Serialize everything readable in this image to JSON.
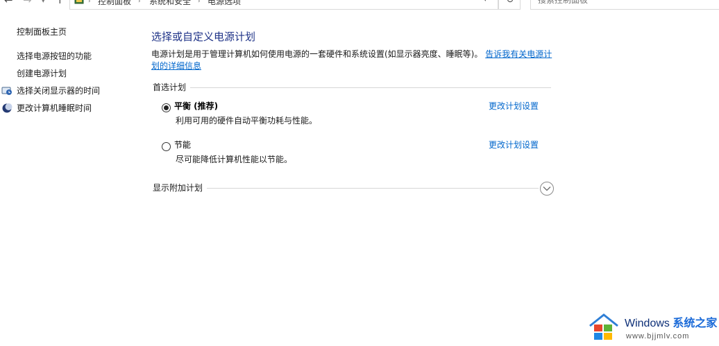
{
  "address_bar": {
    "breadcrumbs": [
      "控制面板",
      "系统和安全",
      "电源选项"
    ],
    "search_placeholder": "搜索控制面板"
  },
  "sidebar": {
    "home": "控制面板主页",
    "items": [
      {
        "label": "选择电源按钮的功能"
      },
      {
        "label": "创建电源计划"
      },
      {
        "label": "选择关闭显示器的时间"
      },
      {
        "label": "更改计算机睡眠时间"
      }
    ]
  },
  "main": {
    "title": "选择或自定义电源计划",
    "description": "电源计划是用于管理计算机如何使用电源的一套硬件和系统设置(如显示器亮度、睡眠等)。",
    "description_link": "告诉我有关电源计划的详细信息",
    "preferred_label": "首选计划",
    "plans": [
      {
        "name": "平衡 (推荐)",
        "desc": "利用可用的硬件自动平衡功耗与性能。",
        "link": "更改计划设置",
        "selected": true
      },
      {
        "name": "节能",
        "desc": "尽可能降低计算机性能以节能。",
        "link": "更改计划设置",
        "selected": false
      }
    ],
    "additional_label": "显示附加计划"
  },
  "watermark": {
    "brand": "Windows",
    "brand_cn": "系统之家",
    "url": "www.bjjmlv.com"
  },
  "colors": {
    "title": "#1e3287",
    "link": "#0066cc"
  }
}
